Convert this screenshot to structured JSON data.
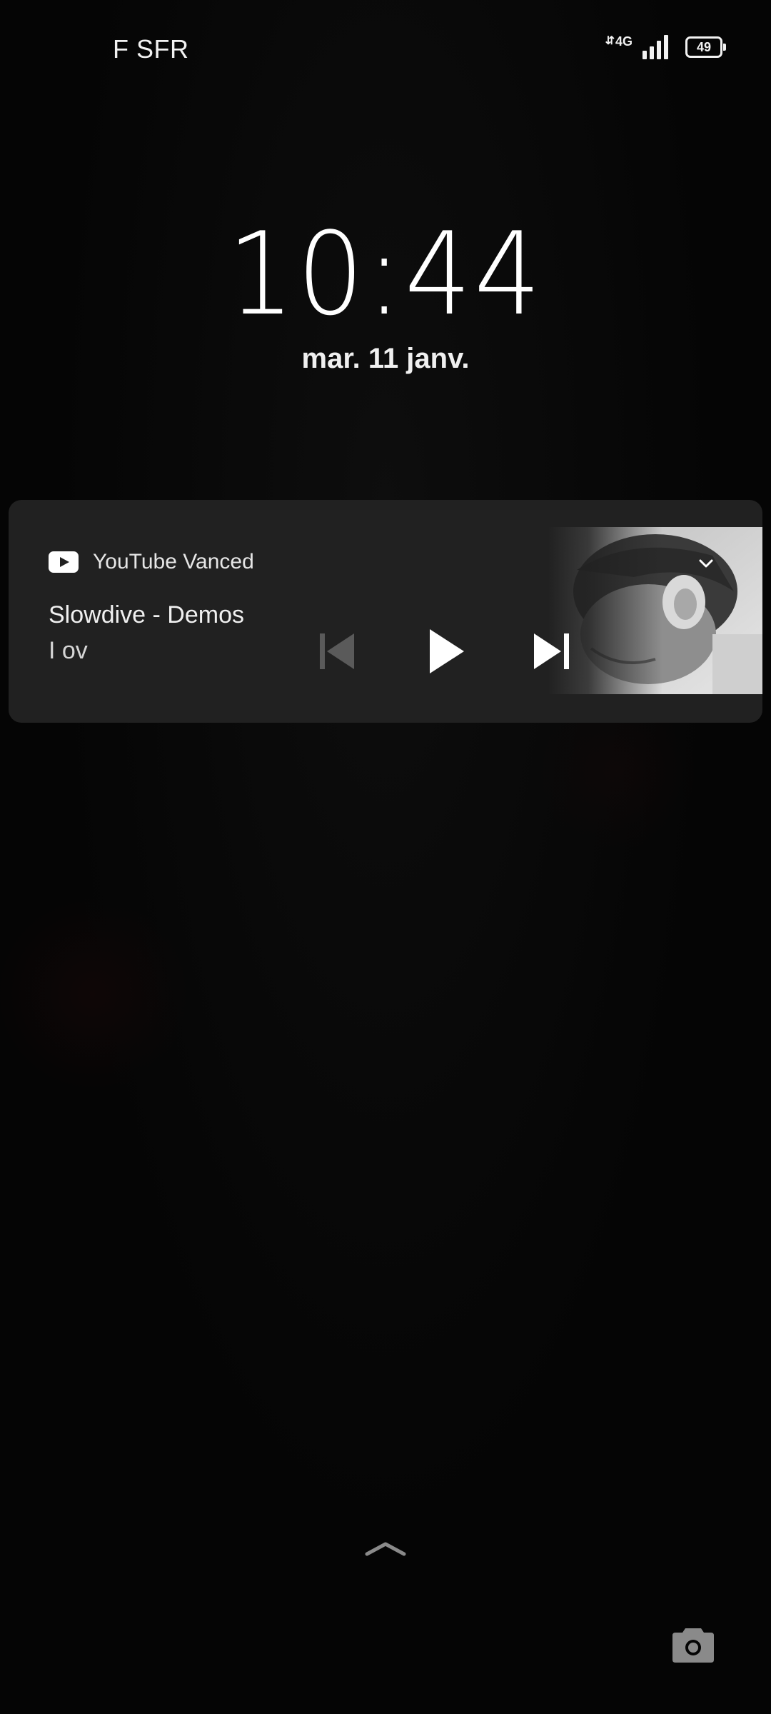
{
  "status_bar": {
    "carrier": "F SFR",
    "network_type": "4G",
    "battery_level": "49",
    "signal_strength_bars": 4
  },
  "lock_screen": {
    "time": "10:44",
    "date": "mar. 11 janv."
  },
  "media_notification": {
    "app_name": "YouTube Vanced",
    "app_icon": "youtube-icon",
    "track_title": "Slowdive - Demos",
    "track_artist": "I ov",
    "controls": {
      "previous": {
        "icon": "skip-previous-icon",
        "enabled": false
      },
      "play": {
        "icon": "play-icon",
        "enabled": true
      },
      "next": {
        "icon": "skip-next-icon",
        "enabled": true
      }
    },
    "expand_icon": "chevron-down-icon"
  },
  "bottom": {
    "unlock_hint_icon": "chevron-up-icon",
    "camera_icon": "camera-icon"
  },
  "colors": {
    "background": "#050505",
    "card_background": "#212121",
    "text_primary": "#ffffff",
    "control_disabled": "#5a5a5a",
    "icon_gray": "#8a8a8a"
  }
}
